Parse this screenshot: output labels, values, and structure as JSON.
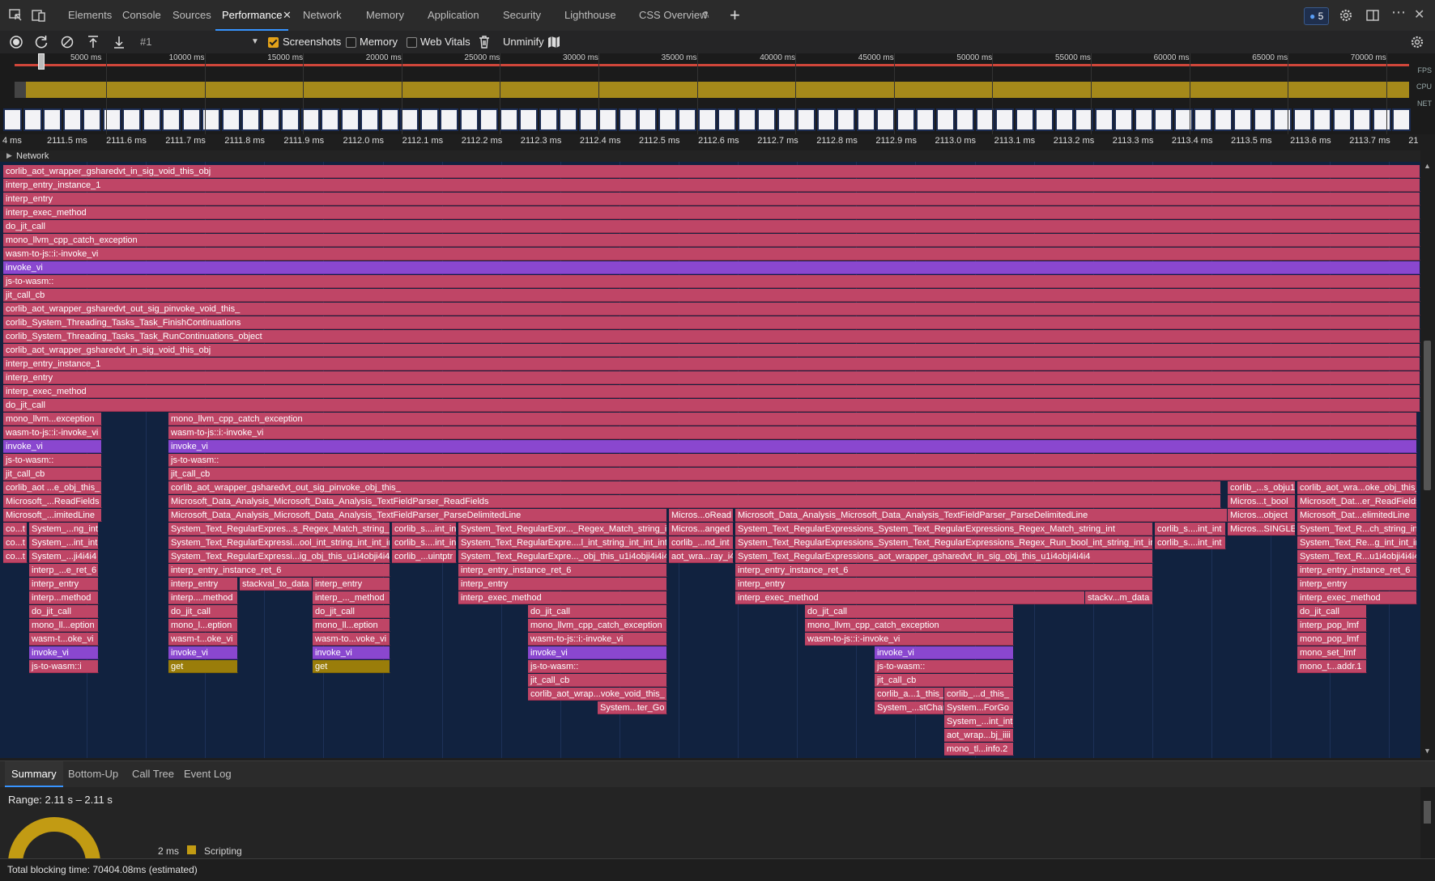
{
  "tabs": [
    {
      "label": "Elements"
    },
    {
      "label": "Console"
    },
    {
      "label": "Sources"
    },
    {
      "label": "Performance"
    },
    {
      "label": "Network"
    },
    {
      "label": "Memory"
    },
    {
      "label": "Application"
    },
    {
      "label": "Security"
    },
    {
      "label": "Lighthouse"
    },
    {
      "label": "CSS Overview"
    }
  ],
  "issues_count": "5",
  "toolbar": {
    "profile": "#1",
    "screenshots": "Screenshots",
    "memory": "Memory",
    "webvitals": "Web Vitals",
    "unminify": "Unminify",
    "screenshots_checked": true,
    "memory_checked": false,
    "webvitals_checked": false
  },
  "overview": {
    "ticks": [
      "5000 ms",
      "10000 ms",
      "15000 ms",
      "20000 ms",
      "25000 ms",
      "30000 ms",
      "35000 ms",
      "40000 ms",
      "45000 ms",
      "50000 ms",
      "55000 ms",
      "60000 ms",
      "65000 ms",
      "70000 ms"
    ],
    "fps_label": "FPS",
    "cpu_label": "CPU",
    "net_label": "NET"
  },
  "ruler": [
    "4 ms",
    "2111.5 ms",
    "2111.6 ms",
    "2111.7 ms",
    "2111.8 ms",
    "2111.9 ms",
    "2112.0 ms",
    "2112.1 ms",
    "2112.2 ms",
    "2112.3 ms",
    "2112.4 ms",
    "2112.5 ms",
    "2112.6 ms",
    "2112.7 ms",
    "2112.8 ms",
    "2112.9 ms",
    "2113.0 ms",
    "2113.1 ms",
    "2113.2 ms",
    "2113.3 ms",
    "2113.4 ms",
    "2113.5 ms",
    "2113.6 ms",
    "2113.7 ms",
    "21"
  ],
  "network_track": "Network",
  "flame": {
    "full_rows": [
      "corlib_aot_wrapper_gsharedvt_in_sig_void_this_obj",
      "interp_entry_instance_1",
      "interp_entry",
      "interp_exec_method",
      "do_jit_call",
      "mono_llvm_cpp_catch_exception",
      "wasm-to-js::i:-invoke_vi",
      "invoke_vi",
      "js-to-wasm::",
      "jit_call_cb",
      "corlib_aot_wrapper_gsharedvt_out_sig_pinvoke_void_this_",
      "corlib_System_Threading_Tasks_Task_FinishContinuations",
      "corlib_System_Threading_Tasks_Task_RunContinuations_object",
      "corlib_aot_wrapper_gsharedvt_in_sig_void_this_obj",
      "interp_entry_instance_1",
      "interp_entry",
      "interp_exec_method",
      "do_jit_call"
    ],
    "bars": [
      {
        "row": 18,
        "text": "mono_llvm...exception",
        "t": "p"
      },
      {
        "row": 18,
        "text": "mono_llvm_cpp_catch_exception",
        "t": "p"
      },
      {
        "row": 19,
        "text": "wasm-to-js::i:-invoke_vi",
        "t": "p"
      },
      {
        "row": 19,
        "text": "wasm-to-js::i:-invoke_vi",
        "t": "p"
      },
      {
        "row": 20,
        "text": "invoke_vi",
        "t": "v"
      },
      {
        "row": 20,
        "text": "invoke_vi",
        "t": "v"
      },
      {
        "row": 21,
        "text": "js-to-wasm::",
        "t": "p"
      },
      {
        "row": 21,
        "text": "js-to-wasm::",
        "t": "p"
      },
      {
        "row": 22,
        "text": "jit_call_cb",
        "t": "p"
      },
      {
        "row": 22,
        "text": "jit_call_cb",
        "t": "p"
      },
      {
        "row": 23,
        "text": "corlib_aot ...e_obj_this_",
        "t": "p"
      },
      {
        "row": 23,
        "text": "corlib_aot_wrapper_gsharedvt_out_sig_pinvoke_obj_this_",
        "t": "p"
      },
      {
        "row": 23,
        "text": "corlib_...s_obju1",
        "t": "p"
      },
      {
        "row": 23,
        "text": "corlib_aot_wra...oke_obj_this_",
        "t": "p"
      },
      {
        "row": 24,
        "text": "Microsoft_...ReadFields",
        "t": "p"
      },
      {
        "row": 24,
        "text": "Microsoft_Data_Analysis_Microsoft_Data_Analysis_TextFieldParser_ReadFields",
        "t": "p"
      },
      {
        "row": 24,
        "text": "Micros...t_bool",
        "t": "p"
      },
      {
        "row": 24,
        "text": "Microsoft_Dat...er_ReadFields",
        "t": "p"
      },
      {
        "row": 25,
        "text": "Microsoft_...imitedLine",
        "t": "p"
      },
      {
        "row": 25,
        "text": "Microsoft_Data_Analysis_Microsoft_Data_Analysis_TextFieldParser_ParseDelimitedLine",
        "t": "p"
      },
      {
        "row": 25,
        "text": "Micros...oRead",
        "t": "p"
      },
      {
        "row": 25,
        "text": "Microsoft_Data_Analysis_Microsoft_Data_Analysis_TextFieldParser_ParseDelimitedLine",
        "t": "p"
      },
      {
        "row": 25,
        "text": "Micros...object",
        "t": "p"
      },
      {
        "row": 25,
        "text": "Microsoft_Dat...elimitedLine",
        "t": "p"
      },
      {
        "row": 26,
        "text": "co...t",
        "t": "p"
      },
      {
        "row": 26,
        "text": "System_...ng_int",
        "t": "p"
      },
      {
        "row": 26,
        "text": "System_Text_RegularExpres...s_Regex_Match_string_int",
        "t": "p"
      },
      {
        "row": 26,
        "text": "corlib_s....int_int",
        "t": "p"
      },
      {
        "row": 26,
        "text": "System_Text_RegularExpr..._Regex_Match_string_int",
        "t": "p"
      },
      {
        "row": 26,
        "text": "Micros...anged",
        "t": "p"
      },
      {
        "row": 26,
        "text": "System_Text_RegularExpressions_System_Text_RegularExpressions_Regex_Match_string_int",
        "t": "p"
      },
      {
        "row": 26,
        "text": "corlib_s....int_int",
        "t": "p"
      },
      {
        "row": 26,
        "text": "Micros...SINGLE",
        "t": "p"
      },
      {
        "row": 26,
        "text": "System_Text_R...ch_string_int",
        "t": "p"
      },
      {
        "row": 27,
        "text": "co...t",
        "t": "p"
      },
      {
        "row": 27,
        "text": "System_...int_int",
        "t": "p"
      },
      {
        "row": 27,
        "text": "System_Text_RegularExpressi...ool_int_string_int_int_int",
        "t": "p"
      },
      {
        "row": 27,
        "text": "corlib_s....int_int",
        "t": "p"
      },
      {
        "row": 27,
        "text": "System_Text_RegularExpre....l_int_string_int_int_int",
        "t": "p"
      },
      {
        "row": 27,
        "text": "corlib_...nd_int",
        "t": "p"
      },
      {
        "row": 27,
        "text": "System_Text_RegularExpressions_System_Text_RegularExpressions_Regex_Run_bool_int_string_int_int_int",
        "t": "p"
      },
      {
        "row": 27,
        "text": "corlib_s....int_int",
        "t": "p"
      },
      {
        "row": 27,
        "text": "System_Text_Re...g_int_int_int",
        "t": "p"
      },
      {
        "row": 28,
        "text": "co...t",
        "t": "p"
      },
      {
        "row": 28,
        "text": "System_...ji4i4i4",
        "t": "p"
      },
      {
        "row": 28,
        "text": "System_Text_RegularExpressi...ig_obj_this_u1i4obji4i4i4",
        "t": "p"
      },
      {
        "row": 28,
        "text": "corlib_...uintptr",
        "t": "p"
      },
      {
        "row": 28,
        "text": "System_Text_RegularExpre..._obj_this_u1i4obji4i4i4",
        "t": "p"
      },
      {
        "row": 28,
        "text": "aot_wra...ray_i4",
        "t": "p"
      },
      {
        "row": 28,
        "text": "System_Text_RegularExpressions_aot_wrapper_gsharedvt_in_sig_obj_this_u1i4obji4i4i4",
        "t": "p"
      },
      {
        "row": 28,
        "text": "System_Text_R...u1i4obji4i4i4",
        "t": "p"
      },
      {
        "row": 29,
        "text": "interp_...e_ret_6",
        "t": "p"
      },
      {
        "row": 29,
        "text": "interp_entry_instance_ret_6",
        "t": "p"
      },
      {
        "row": 29,
        "text": "interp_entry_instance_ret_6",
        "t": "p"
      },
      {
        "row": 29,
        "text": "interp_entry_instance_ret_6",
        "t": "p"
      },
      {
        "row": 29,
        "text": "interp_entry_instance_ret_6",
        "t": "p"
      },
      {
        "row": 30,
        "text": "interp_entry",
        "t": "p"
      },
      {
        "row": 30,
        "text": "interp_entry",
        "t": "p"
      },
      {
        "row": 30,
        "text": "stackval_to_data",
        "t": "p"
      },
      {
        "row": 30,
        "text": "interp_entry",
        "t": "p"
      },
      {
        "row": 30,
        "text": "interp_entry",
        "t": "p"
      },
      {
        "row": 30,
        "text": "interp_entry",
        "t": "p"
      },
      {
        "row": 30,
        "text": "interp_entry",
        "t": "p"
      },
      {
        "row": 31,
        "text": "interp...method",
        "t": "p"
      },
      {
        "row": 31,
        "text": "interp....method",
        "t": "p"
      },
      {
        "row": 31,
        "text": "interp_..._method",
        "t": "p"
      },
      {
        "row": 31,
        "text": "interp_exec_method",
        "t": "p"
      },
      {
        "row": 31,
        "text": "interp_exec_method",
        "t": "p"
      },
      {
        "row": 31,
        "text": "stackv...m_data",
        "t": "p"
      },
      {
        "row": 31,
        "text": "interp_exec_method",
        "t": "p"
      },
      {
        "row": 32,
        "text": "do_jit_call",
        "t": "p"
      },
      {
        "row": 32,
        "text": "do_jit_call",
        "t": "p"
      },
      {
        "row": 32,
        "text": "do_jit_call",
        "t": "p"
      },
      {
        "row": 32,
        "text": "do_jit_call",
        "t": "p"
      },
      {
        "row": 32,
        "text": "do_jit_call",
        "t": "p"
      },
      {
        "row": 32,
        "text": "do_jit_call",
        "t": "p"
      },
      {
        "row": 33,
        "text": "mono_ll...eption",
        "t": "p"
      },
      {
        "row": 33,
        "text": "mono_l...eption",
        "t": "p"
      },
      {
        "row": 33,
        "text": "mono_ll...eption",
        "t": "p"
      },
      {
        "row": 33,
        "text": "mono_llvm_cpp_catch_exception",
        "t": "p"
      },
      {
        "row": 33,
        "text": "mono_llvm_cpp_catch_exception",
        "t": "p"
      },
      {
        "row": 33,
        "text": "interp_pop_lmf",
        "t": "p"
      },
      {
        "row": 34,
        "text": "wasm-t...oke_vi",
        "t": "p"
      },
      {
        "row": 34,
        "text": "wasm-t...oke_vi",
        "t": "p"
      },
      {
        "row": 34,
        "text": "wasm-to...voke_vi",
        "t": "p"
      },
      {
        "row": 34,
        "text": "wasm-to-js::i:-invoke_vi",
        "t": "p"
      },
      {
        "row": 34,
        "text": "wasm-to-js::i:-invoke_vi",
        "t": "p"
      },
      {
        "row": 34,
        "text": "mono_pop_lmf",
        "t": "p"
      },
      {
        "row": 35,
        "text": "invoke_vi",
        "t": "v"
      },
      {
        "row": 35,
        "text": "invoke_vi",
        "t": "v"
      },
      {
        "row": 35,
        "text": "invoke_vi",
        "t": "v"
      },
      {
        "row": 35,
        "text": "invoke_vi",
        "t": "v"
      },
      {
        "row": 35,
        "text": "invoke_vi",
        "t": "v"
      },
      {
        "row": 35,
        "text": "mono_set_lmf",
        "t": "p"
      },
      {
        "row": 36,
        "text": "js-to-wasm::i",
        "t": "p"
      },
      {
        "row": 36,
        "text": "get",
        "t": "y"
      },
      {
        "row": 36,
        "text": "get",
        "t": "y"
      },
      {
        "row": 36,
        "text": "js-to-wasm::",
        "t": "p"
      },
      {
        "row": 36,
        "text": "js-to-wasm::",
        "t": "p"
      },
      {
        "row": 36,
        "text": "mono_t...addr.1",
        "t": "p"
      },
      {
        "row": 37,
        "text": "jit_call_cb",
        "t": "p"
      },
      {
        "row": 37,
        "text": "jit_call_cb",
        "t": "p"
      },
      {
        "row": 38,
        "text": "corlib_aot_wrap...voke_void_this_",
        "t": "p"
      },
      {
        "row": 38,
        "text": "corlib_a...1_this_",
        "t": "p"
      },
      {
        "row": 38,
        "text": "corlib_...d_this_",
        "t": "p"
      },
      {
        "row": 39,
        "text": "System...ter_Go",
        "t": "p"
      },
      {
        "row": 39,
        "text": "System_...stChar",
        "t": "p"
      },
      {
        "row": 39,
        "text": "System...ForGo",
        "t": "p"
      },
      {
        "row": 40,
        "text": "System_...int_int",
        "t": "p"
      },
      {
        "row": 41,
        "text": "aot_wrap...bj_iiii",
        "t": "p"
      },
      {
        "row": 42,
        "text": "mono_tl...info.2",
        "t": "p"
      }
    ]
  },
  "bottom_tabs": [
    {
      "label": "Summary"
    },
    {
      "label": "Bottom-Up"
    },
    {
      "label": "Call Tree"
    },
    {
      "label": "Event Log"
    }
  ],
  "summary": {
    "range": "Range: 2.11 s – 2.11 s",
    "scripting_time": "2 ms",
    "scripting_label": "Scripting",
    "scripting_color": "#c29b13"
  },
  "footer": "Total blocking time: 70404.08ms (estimated)"
}
